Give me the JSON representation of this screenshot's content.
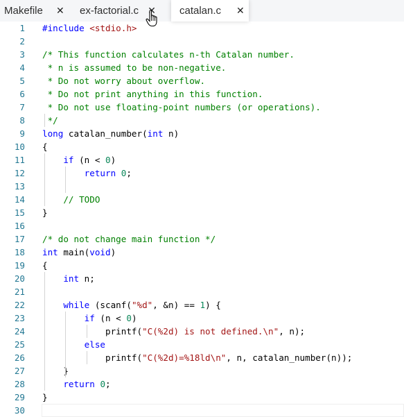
{
  "tabs": [
    {
      "label": "Makefile",
      "close": "✕",
      "active": false
    },
    {
      "label": "ex-factorial.c",
      "close": "✕",
      "active": false
    },
    {
      "label": "catalan.c",
      "close": "✕",
      "active": true
    }
  ],
  "editor": {
    "lines": [
      {
        "n": "1",
        "tokens": [
          [
            "pp",
            "#include "
          ],
          [
            "inc",
            "<stdio.h>"
          ]
        ]
      },
      {
        "n": "2",
        "tokens": []
      },
      {
        "n": "3",
        "tokens": [
          [
            "cm",
            "/* This function calculates n-th Catalan number."
          ]
        ]
      },
      {
        "n": "4",
        "tokens": [
          [
            "cm",
            " * n is assumed to be non-negative."
          ]
        ]
      },
      {
        "n": "5",
        "tokens": [
          [
            "cm",
            " * Do not worry about overflow."
          ]
        ]
      },
      {
        "n": "6",
        "tokens": [
          [
            "cm",
            " * Do not print anything in this function."
          ]
        ]
      },
      {
        "n": "7",
        "tokens": [
          [
            "cm",
            " * Do not use floating-point numbers (or operations)."
          ]
        ]
      },
      {
        "n": "8",
        "tokens": [
          [
            "cm",
            " */"
          ]
        ]
      },
      {
        "n": "9",
        "tokens": [
          [
            "kw",
            "long"
          ],
          [
            "fn",
            " catalan_number("
          ],
          [
            "kw",
            "int"
          ],
          [
            "fn",
            " n)"
          ]
        ]
      },
      {
        "n": "10",
        "tokens": [
          [
            "fn",
            "{"
          ]
        ]
      },
      {
        "n": "11",
        "tokens": [
          [
            "fn",
            "    "
          ],
          [
            "kw",
            "if"
          ],
          [
            "fn",
            " (n < "
          ],
          [
            "num",
            "0"
          ],
          [
            "fn",
            ")"
          ]
        ]
      },
      {
        "n": "12",
        "tokens": [
          [
            "fn",
            "        "
          ],
          [
            "kw",
            "return"
          ],
          [
            "fn",
            " "
          ],
          [
            "num",
            "0"
          ],
          [
            "fn",
            ";"
          ]
        ]
      },
      {
        "n": "13",
        "tokens": []
      },
      {
        "n": "14",
        "tokens": [
          [
            "fn",
            "    "
          ],
          [
            "cm",
            "// TODO"
          ]
        ]
      },
      {
        "n": "15",
        "tokens": [
          [
            "fn",
            "}"
          ]
        ]
      },
      {
        "n": "16",
        "tokens": []
      },
      {
        "n": "17",
        "tokens": [
          [
            "cm",
            "/* do not change main function */"
          ]
        ]
      },
      {
        "n": "18",
        "tokens": [
          [
            "kw",
            "int"
          ],
          [
            "fn",
            " main("
          ],
          [
            "kw",
            "void"
          ],
          [
            "fn",
            ")"
          ]
        ]
      },
      {
        "n": "19",
        "tokens": [
          [
            "fn",
            "{"
          ]
        ]
      },
      {
        "n": "20",
        "tokens": [
          [
            "fn",
            "    "
          ],
          [
            "kw",
            "int"
          ],
          [
            "fn",
            " n;"
          ]
        ]
      },
      {
        "n": "21",
        "tokens": []
      },
      {
        "n": "22",
        "tokens": [
          [
            "fn",
            "    "
          ],
          [
            "kw",
            "while"
          ],
          [
            "fn",
            " (scanf("
          ],
          [
            "str",
            "\"%d\""
          ],
          [
            "fn",
            ", &n) == "
          ],
          [
            "num",
            "1"
          ],
          [
            "fn",
            ") {"
          ]
        ]
      },
      {
        "n": "23",
        "tokens": [
          [
            "fn",
            "        "
          ],
          [
            "kw",
            "if"
          ],
          [
            "fn",
            " (n < "
          ],
          [
            "num",
            "0"
          ],
          [
            "fn",
            ")"
          ]
        ]
      },
      {
        "n": "24",
        "tokens": [
          [
            "fn",
            "            printf("
          ],
          [
            "str",
            "\"C(%2d) is not defined.\\n\""
          ],
          [
            "fn",
            ", n);"
          ]
        ]
      },
      {
        "n": "25",
        "tokens": [
          [
            "fn",
            "        "
          ],
          [
            "kw",
            "else"
          ]
        ]
      },
      {
        "n": "26",
        "tokens": [
          [
            "fn",
            "            printf("
          ],
          [
            "str",
            "\"C(%2d)=%18ld\\n\""
          ],
          [
            "fn",
            ", n, catalan_number(n));"
          ]
        ]
      },
      {
        "n": "27",
        "tokens": [
          [
            "fn",
            "    }"
          ]
        ]
      },
      {
        "n": "28",
        "tokens": [
          [
            "fn",
            "    "
          ],
          [
            "kw",
            "return"
          ],
          [
            "fn",
            " "
          ],
          [
            "num",
            "0"
          ],
          [
            "fn",
            ";"
          ]
        ]
      },
      {
        "n": "29",
        "tokens": [
          [
            "fn",
            "}"
          ]
        ]
      },
      {
        "n": "30",
        "tokens": []
      }
    ]
  }
}
